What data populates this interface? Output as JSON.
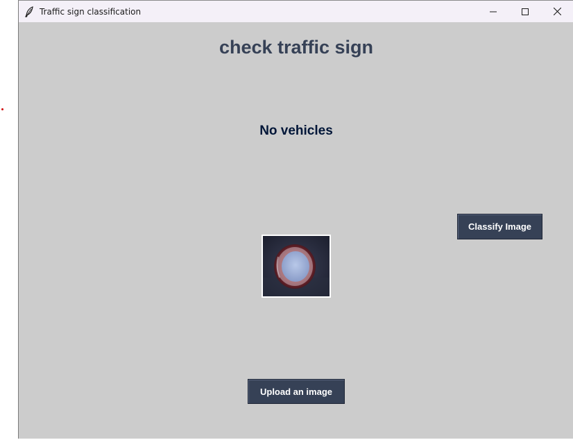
{
  "window": {
    "title": "Traffic sign classification",
    "icon": "feather-icon",
    "controls": [
      "minimize-icon",
      "maximize-icon",
      "close-icon"
    ]
  },
  "main": {
    "heading": "check traffic sign",
    "result_label": "No vehicles",
    "classify_button": "Classify Image",
    "upload_button": "Upload an image",
    "uploaded_image": "traffic-sign-no-vehicles"
  },
  "colors": {
    "background": "#cccccc",
    "heading": "#364156",
    "result": "#011638",
    "button_bg": "#364156",
    "button_text": "#ffffff"
  }
}
